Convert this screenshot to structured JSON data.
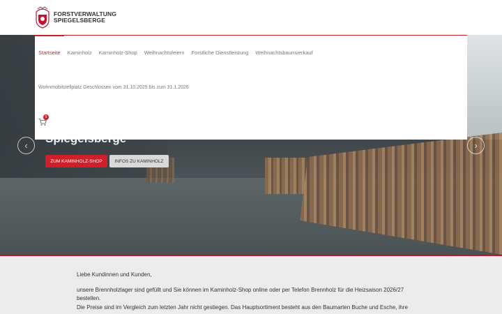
{
  "brand": {
    "line1": "FORSTVERWALTUNG",
    "line2": "SPIEGELSBERGE",
    "accent_color": "#d01f28"
  },
  "nav": {
    "items": [
      {
        "label": "Startseite",
        "active": true
      },
      {
        "label": "Kaminholz"
      },
      {
        "label": "Kaminholz-Shop"
      },
      {
        "label": "Weihnachtsfeiern"
      },
      {
        "label": "Forstliche Dienstleistung"
      },
      {
        "label": "Weihnachtsbaumverkauf"
      }
    ],
    "notice": "Wohnmobilstellplatz Geschlossen vom 31.10.2025 bis zum 31.1.2026",
    "cart_count": "0",
    "cart_icon": "cart-icon"
  },
  "hero": {
    "title": "Spiegelsberge",
    "primary_button": "ZUM KAMINHOLZ-SHOP",
    "secondary_button": "INFOS ZU KAMINHOLZ",
    "prev_icon": "chevron-left-icon",
    "next_icon": "chevron-right-icon"
  },
  "content": {
    "greeting": "Liebe Kundinnen und Kunden,",
    "paragraph1": "unsere Brennholzlager sind gefüllt und Sie können im Kaminholz-Shop online oder per Telefon Brennholz für die Heizsaison 2026/27 bestellen.",
    "paragraph2": "Die Preise sind im Vergleich zum letzten Jahr nicht gestiegen. Das Hauptsortiment besteht aus den Baumarten Buche und Esche, ihre"
  }
}
